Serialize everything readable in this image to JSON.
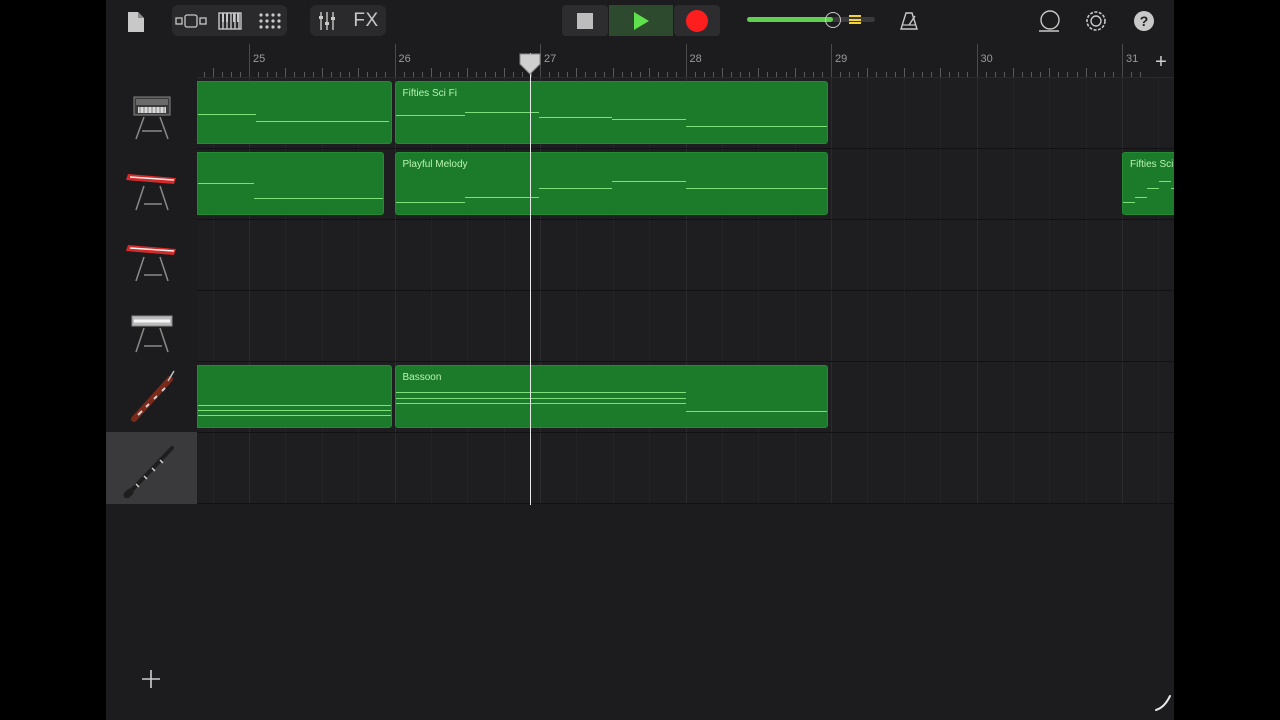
{
  "toolbar": {
    "fx_label": "FX",
    "icons": [
      "document-icon",
      "tracks-view-icon",
      "keyboard-icon",
      "grid-icon",
      "mixer-icon",
      "fx-button",
      "stop-icon",
      "play-icon",
      "record-icon",
      "metronome-icon",
      "loop-icon",
      "settings-icon",
      "help-icon"
    ],
    "volume_level": 0.67,
    "colors": {
      "play": "#5fe04d",
      "record": "#ff1e1e",
      "volume": "#5fd04f",
      "region": "#1c7a2b"
    }
  },
  "ruler": {
    "bars": [
      "25",
      "26",
      "27",
      "28",
      "29",
      "30",
      "31"
    ],
    "add_label": "+"
  },
  "playhead_position_bar": 26.93,
  "tracks": [
    {
      "instrument": "synth-keyboard-icon",
      "selected": false
    },
    {
      "instrument": "red-keyboard-icon",
      "selected": false
    },
    {
      "instrument": "red-keyboard-icon",
      "selected": false
    },
    {
      "instrument": "white-keyboard-icon",
      "selected": false
    },
    {
      "instrument": "bassoon-icon",
      "selected": false
    },
    {
      "instrument": "clarinet-icon",
      "selected": true
    }
  ],
  "regions": [
    {
      "track": 0,
      "start_bar": 24.6,
      "end_bar": 25.98,
      "label": ""
    },
    {
      "track": 0,
      "start_bar": 26.0,
      "end_bar": 28.98,
      "label": "Fifties Sci Fi"
    },
    {
      "track": 1,
      "start_bar": 24.6,
      "end_bar": 25.93,
      "label": ""
    },
    {
      "track": 1,
      "start_bar": 26.0,
      "end_bar": 28.98,
      "label": "Playful Melody"
    },
    {
      "track": 1,
      "start_bar": 31.0,
      "end_bar": 31.5,
      "label": "Fifties Sci Fi"
    },
    {
      "track": 4,
      "start_bar": 24.6,
      "end_bar": 25.98,
      "label": ""
    },
    {
      "track": 4,
      "start_bar": 26.0,
      "end_bar": 28.98,
      "label": "Bassoon"
    }
  ],
  "add_track_label": "+"
}
